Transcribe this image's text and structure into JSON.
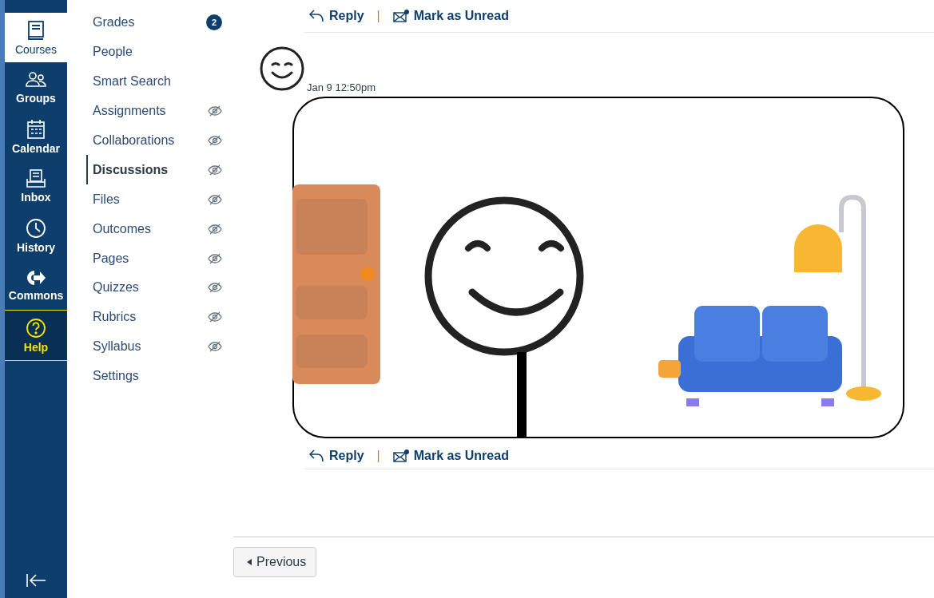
{
  "global_nav": [
    {
      "label": "Courses",
      "selected": true,
      "kind": "normal"
    },
    {
      "label": "Groups",
      "selected": false,
      "kind": "normal"
    },
    {
      "label": "Calendar",
      "selected": false,
      "kind": "normal"
    },
    {
      "label": "Inbox",
      "selected": false,
      "kind": "normal"
    },
    {
      "label": "History",
      "selected": false,
      "kind": "normal"
    },
    {
      "label": "Commons",
      "selected": false,
      "kind": "normal"
    },
    {
      "label": "Help",
      "selected": false,
      "kind": "help"
    }
  ],
  "course_nav": [
    {
      "label": "Grades",
      "selected": false,
      "hidden": false,
      "badge": "2"
    },
    {
      "label": "People",
      "selected": false,
      "hidden": false
    },
    {
      "label": "Smart Search",
      "selected": false,
      "hidden": false
    },
    {
      "label": "Assignments",
      "selected": false,
      "hidden": true
    },
    {
      "label": "Collaborations",
      "selected": false,
      "hidden": true
    },
    {
      "label": "Discussions",
      "selected": true,
      "hidden": true
    },
    {
      "label": "Files",
      "selected": false,
      "hidden": true
    },
    {
      "label": "Outcomes",
      "selected": false,
      "hidden": true
    },
    {
      "label": "Pages",
      "selected": false,
      "hidden": true
    },
    {
      "label": "Quizzes",
      "selected": false,
      "hidden": true
    },
    {
      "label": "Rubrics",
      "selected": false,
      "hidden": true
    },
    {
      "label": "Syllabus",
      "selected": false,
      "hidden": true
    },
    {
      "label": "Settings",
      "selected": false,
      "hidden": false
    }
  ],
  "top_actions": {
    "reply": "Reply",
    "separator": "|",
    "mark_unread": "Mark as Unread"
  },
  "entry": {
    "timestamp": "Jan 9 12:50pm",
    "actions": {
      "reply": "Reply",
      "separator": "|",
      "mark_unread": "Mark as Unread"
    }
  },
  "pagination": {
    "previous": "Previous"
  }
}
